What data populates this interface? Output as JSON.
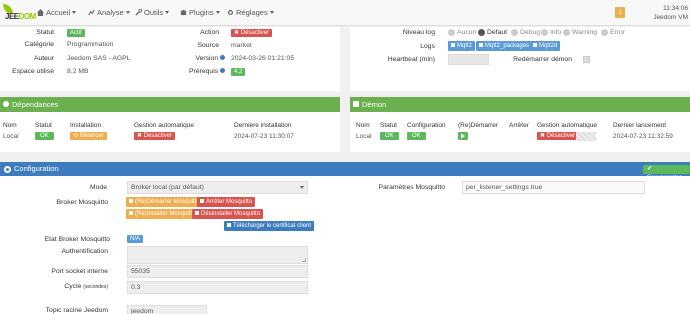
{
  "nav": {
    "logo_prefix": "JEE",
    "logo_suffix": "DOM",
    "items": [
      "Accueil",
      "Analyse",
      "Outils",
      "Plugins",
      "Réglages"
    ],
    "notif_count": "1",
    "time": "11:34:06",
    "user": "Jeedom VM"
  },
  "info": {
    "statut_label": "Statut",
    "statut_value": "Actif",
    "categorie_label": "Catégorie",
    "categorie_value": "Programmation",
    "auteur_label": "Auteur",
    "auteur_value": "Jeedom SAS - AGPL",
    "espace_label": "Espace utilisé",
    "espace_value": "8.2 MB",
    "action_label": "Action",
    "action_value": "Désactiver",
    "source_label": "Source",
    "source_value": "market",
    "version_label": "Version",
    "version_value": "2024-03-26 01:21:05",
    "prerequis_label": "Prérequis",
    "prerequis_value": "4.2"
  },
  "logs": {
    "niveau_label": "Niveau log",
    "levels": [
      "Aucun",
      "Defaut",
      "Debug",
      "Info",
      "Warning",
      "Error"
    ],
    "selected": "Defaut",
    "logs_label": "Logs",
    "log_buttons": [
      "Mqtt2",
      "Mqtt2_packages",
      "Mqtt2d"
    ],
    "heartbeat_label": "Heartbeat (min)",
    "restart_label": "Redémarrer démon"
  },
  "dependances": {
    "title": "Dépendances",
    "headers": [
      "Nom",
      "Statut",
      "Installation",
      "Gestion automatique",
      "Dernière installation"
    ],
    "row": {
      "nom": "Local",
      "statut": "OK",
      "installation": "Relancer",
      "gestion": "Désactiver",
      "date": "2024-07-23 11:30:07"
    }
  },
  "demon": {
    "title": "Démon",
    "headers": [
      "Nom",
      "Statut",
      "Configuration",
      "(Re)Démarrer",
      "Arrêter",
      "Gestion automatique",
      "Dernier lancement"
    ],
    "row": {
      "nom": "Local",
      "statut": "OK",
      "configuration": "OK",
      "gestion": "Désactiver",
      "date": "2024-07-23 11:32:59"
    }
  },
  "config": {
    "title": "Configuration",
    "save_label": "Sauvegarder",
    "mode_label": "Mode",
    "mode_value": "Broker local (par défaut)",
    "broker_label": "Broker Mosquitto",
    "btn_restart": "(Re)Démarrer Mosquitto",
    "btn_stop": "Arrêter Mosquitto",
    "btn_reinstall": "(Ré)Installer Mosquitto",
    "btn_uninstall": "Désinstaller Mosquitto",
    "btn_cert": "Télécharger le certificat client",
    "etat_label": "Etat Broker Mosquitto",
    "etat_value": "N/A",
    "auth_label": "Authentification",
    "port_label": "Port socket interne",
    "port_value": "55035",
    "cycle_label": "Cycle",
    "cycle_unit": "(secondes)",
    "cycle_value": "0.3",
    "topic_label": "Topic racine Jeedom",
    "topic_value": "jeedom",
    "params_label": "Paramètres Mosquitto",
    "params_value": "per_listener_settings true"
  },
  "colors": {
    "green": "#6bb04f",
    "blue": "#3d7dbf",
    "red": "#d9534f",
    "orange": "#f0ad4e"
  }
}
